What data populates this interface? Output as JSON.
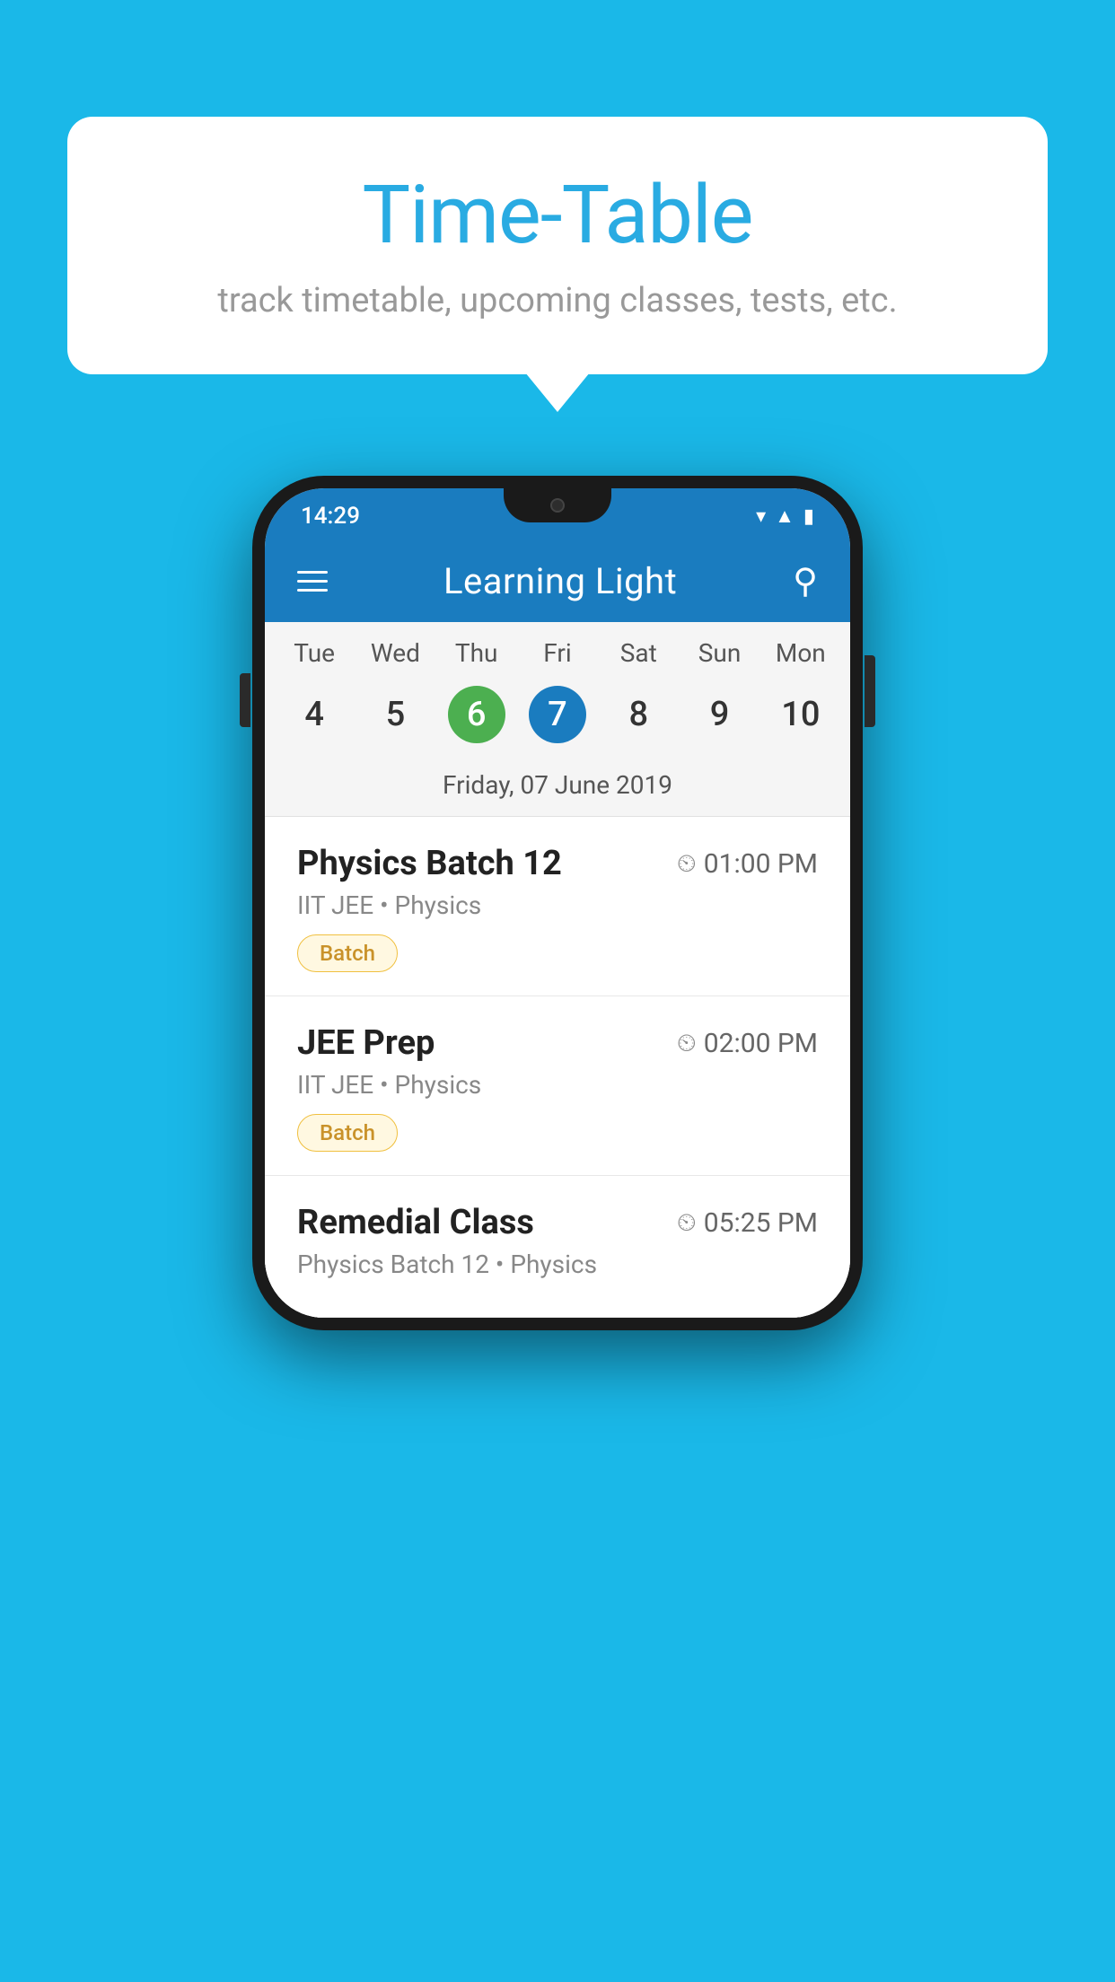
{
  "background_color": "#1ab8e8",
  "speech_bubble": {
    "title": "Time-Table",
    "subtitle": "track timetable, upcoming classes, tests, etc."
  },
  "phone": {
    "status_bar": {
      "time": "14:29",
      "icons": [
        "wifi",
        "signal",
        "battery"
      ]
    },
    "app_bar": {
      "title": "Learning Light",
      "menu_icon": "hamburger",
      "search_icon": "search"
    },
    "calendar": {
      "days": [
        {
          "label": "Tue",
          "num": "4"
        },
        {
          "label": "Wed",
          "num": "5"
        },
        {
          "label": "Thu",
          "num": "6",
          "state": "today"
        },
        {
          "label": "Fri",
          "num": "7",
          "state": "selected"
        },
        {
          "label": "Sat",
          "num": "8"
        },
        {
          "label": "Sun",
          "num": "9"
        },
        {
          "label": "Mon",
          "num": "10"
        }
      ],
      "selected_date_label": "Friday, 07 June 2019"
    },
    "classes": [
      {
        "name": "Physics Batch 12",
        "time": "01:00 PM",
        "meta": "IIT JEE • Physics",
        "badge": "Batch"
      },
      {
        "name": "JEE Prep",
        "time": "02:00 PM",
        "meta": "IIT JEE • Physics",
        "badge": "Batch"
      },
      {
        "name": "Remedial Class",
        "time": "05:25 PM",
        "meta": "Physics Batch 12 • Physics",
        "badge": null
      }
    ]
  }
}
